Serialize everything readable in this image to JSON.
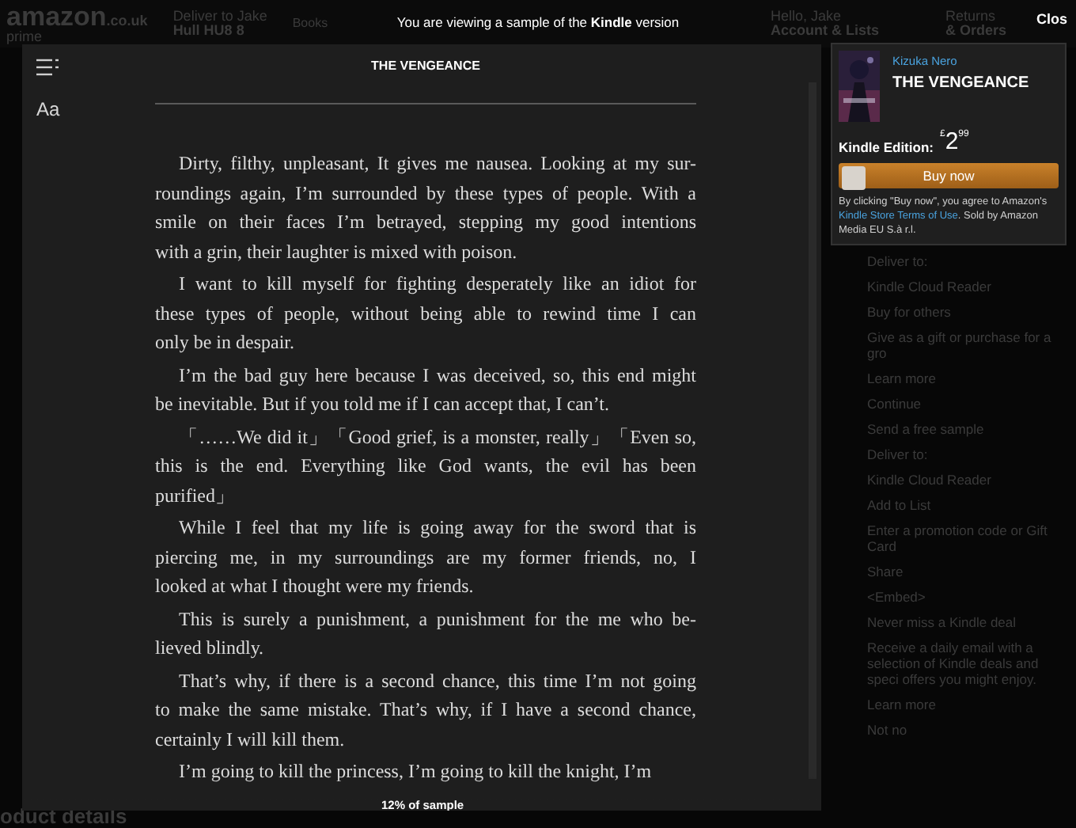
{
  "background_page": {
    "header": {
      "logo": "amazon",
      "logo_region": ".co.uk",
      "logo_sub": "prime",
      "deliver_label": "Deliver to Jake",
      "deliver_place": "Hull HU8 8",
      "search_category": "Books",
      "account_greeting": "Hello, Jake",
      "account_link": "Account & Lists",
      "returns_label": "Returns",
      "orders_link": "& Orders"
    },
    "side_panel": [
      "Deliver to:",
      "Kindle Cloud Reader",
      "Buy for others",
      "Give as a gift or purchase for a gro",
      "Learn more",
      "Continue",
      "Send a free sample",
      "Deliver to:",
      "Kindle Cloud Reader",
      "Add to List",
      "Enter a promotion code or Gift Card",
      "Share",
      "<Embed>",
      "Never miss a Kindle deal",
      "Receive a daily email with a selection of Kindle deals and speci offers you might enjoy.",
      "Learn more",
      "Not no"
    ],
    "footer_heading": "oduct details"
  },
  "banner": {
    "text": "You are viewing a sample of the **Kindle** version",
    "close": "Clos"
  },
  "reader": {
    "font_button": "Aa",
    "title": "THE VENGEANCE",
    "progress": "12% of sample",
    "paragraphs": [
      [
        "Dirty, filthy, unpleasant, It gives me nausea. Looking at my sur-",
        "roundings again, I’m surrounded by these types of people. With a",
        "smile on their faces I’m betrayed, stepping my good intentions",
        "with a grin, their laughter is mixed with poison."
      ],
      [
        "I want to kill myself for fighting desperately like an idiot for",
        "these types of people, without being able to rewind time I can",
        "only be in despair."
      ],
      [
        "I’m the bad guy here because I was deceived, so, this end might",
        "be inevitable. But if you told me if I can accept that, I can’t."
      ],
      [
        "「……We did it」「Good grief, is a monster, really」「Even so,",
        "this is the end. Everything like God wants, the evil has been",
        "purified」"
      ],
      [
        "While I feel that my life is going away for the sword that is",
        "piercing me, in my surroundings are my former friends, no, I",
        "looked at what I thought were my friends."
      ],
      [
        "This is surely a punishment, a punishment for the me who be-",
        "lieved blindly."
      ],
      [
        "That’s why, if there is a second chance, this time I’m not going",
        "to make the same mistake. That’s why, if I have a second chance,",
        "certainly I will kill them."
      ],
      [
        "I’m going to kill the princess, I’m going to kill the knight, I’m"
      ]
    ]
  },
  "purchase_popup": {
    "author": "Kizuka Nero",
    "title": "THE VENGEANCE",
    "price_label": "Kindle Edition:",
    "currency": "£",
    "price_whole": "2",
    "price_fraction": "99",
    "buy_button": "Buy now",
    "terms_before": "By clicking \"Buy now\", you agree to Amazon's",
    "terms_link": "Kindle Store Terms of Use",
    "terms_after": ". Sold by Amazon Media EU S.à r.l."
  }
}
